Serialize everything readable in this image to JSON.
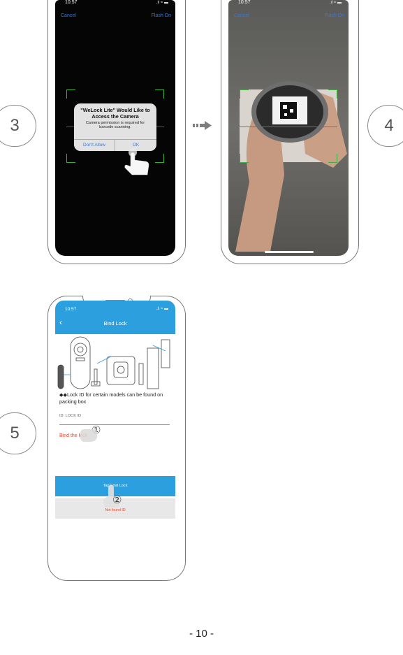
{
  "steps": {
    "s3": "3",
    "s4": "4",
    "s5": "5"
  },
  "status_time": "10:57",
  "scan3": {
    "cancel": "Cancel",
    "flash": "Flash On"
  },
  "scan4": {
    "cancel": "Cancel",
    "flash": "Flash On"
  },
  "dialog": {
    "title": "\"WeLock Lite\" Would Like to Access the Camera",
    "message": "Camera permission is required for barcode scanning.",
    "deny": "Don't Allow",
    "ok": "OK"
  },
  "bind": {
    "header_title": "Bind Lock",
    "note": "◆◆Lock ID for certain models can be found on packing box",
    "field_label": "ID: LOCK ID",
    "bind_label": "Bind the lock",
    "tap_button": "Tap Find Lock",
    "not_found": "Not found ID",
    "badge1": "①",
    "badge2": "②"
  },
  "page_number": "- 10 -",
  "colors": {
    "accent": "#2c9fde",
    "red": "#e8452b",
    "green": "#3fae3f"
  }
}
